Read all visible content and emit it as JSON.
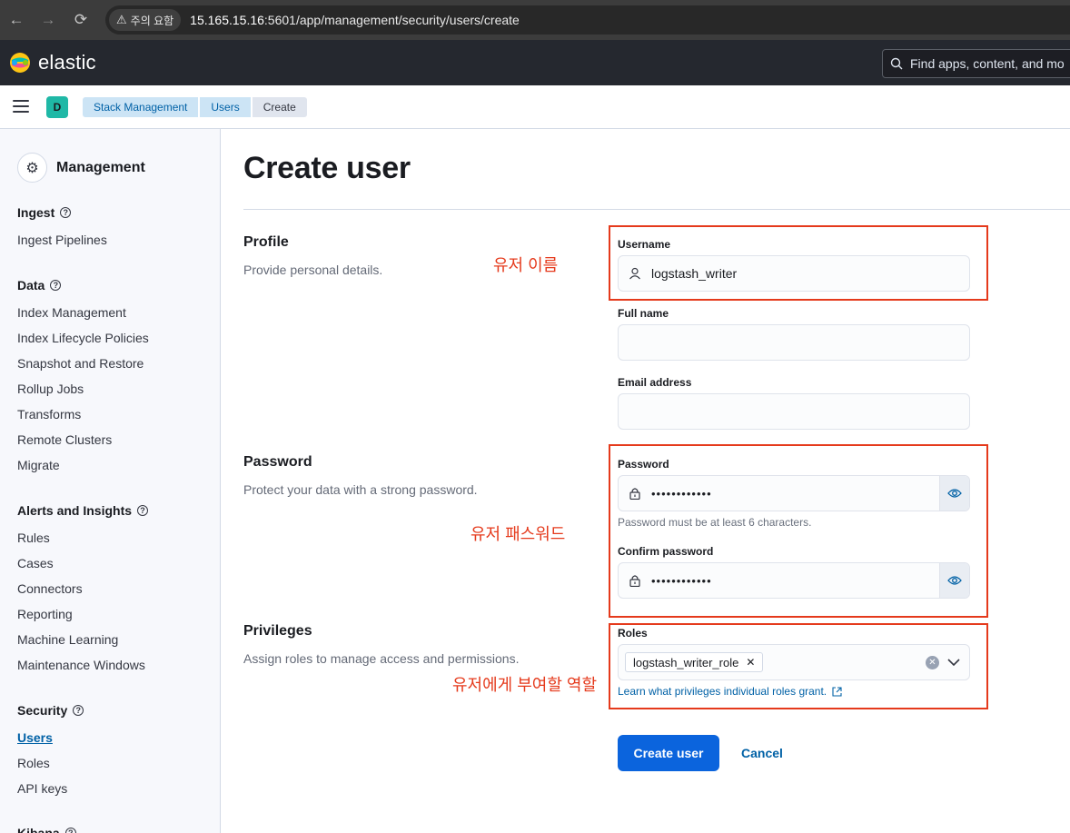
{
  "browser": {
    "back_icon": "←",
    "forward_icon": "→",
    "reload_icon": "⟳",
    "warning_label": "주의 요함",
    "url_host": "15.165.15.16",
    "url_rest": ":5601/app/management/security/users/create"
  },
  "header": {
    "brand": "elastic",
    "search_placeholder": "Find apps, content, and mo"
  },
  "breadcrumbs": {
    "space_initial": "D",
    "items": [
      "Stack Management",
      "Users",
      "Create"
    ]
  },
  "sidebar": {
    "title": "Management",
    "sections": [
      {
        "label": "Ingest",
        "items": [
          "Ingest Pipelines"
        ]
      },
      {
        "label": "Data",
        "items": [
          "Index Management",
          "Index Lifecycle Policies",
          "Snapshot and Restore",
          "Rollup Jobs",
          "Transforms",
          "Remote Clusters",
          "Migrate"
        ]
      },
      {
        "label": "Alerts and Insights",
        "items": [
          "Rules",
          "Cases",
          "Connectors",
          "Reporting",
          "Machine Learning",
          "Maintenance Windows"
        ]
      },
      {
        "label": "Security",
        "items": [
          "Users",
          "Roles",
          "API keys"
        ]
      },
      {
        "label": "Kibana",
        "items": []
      }
    ],
    "active_item": "Users"
  },
  "main": {
    "title": "Create user",
    "profile": {
      "title": "Profile",
      "description": "Provide personal details.",
      "username_label": "Username",
      "username_value": "logstash_writer",
      "fullname_label": "Full name",
      "fullname_value": "",
      "email_label": "Email address",
      "email_value": ""
    },
    "password": {
      "title": "Password",
      "description": "Protect your data with a strong password.",
      "password_label": "Password",
      "password_value": "••••••••••••",
      "password_help": "Password must be at least 6 characters.",
      "confirm_label": "Confirm password",
      "confirm_value": "••••••••••••"
    },
    "privileges": {
      "title": "Privileges",
      "description": "Assign roles to manage access and permissions.",
      "roles_label": "Roles",
      "roles": [
        "logstash_writer_role"
      ],
      "docs_link": "Learn what privileges individual roles grant."
    },
    "actions": {
      "create_label": "Create user",
      "cancel_label": "Cancel"
    }
  },
  "annotations": {
    "username_note": "유저 이름",
    "password_note": "유저 패스워드",
    "roles_note": "유저에게 부여할 역할",
    "color": "#e53a1c"
  },
  "colors": {
    "primary": "#0b64dd",
    "link": "#0061a6",
    "header_bg": "#25282f",
    "sidebar_bg": "#f7f8fc"
  }
}
